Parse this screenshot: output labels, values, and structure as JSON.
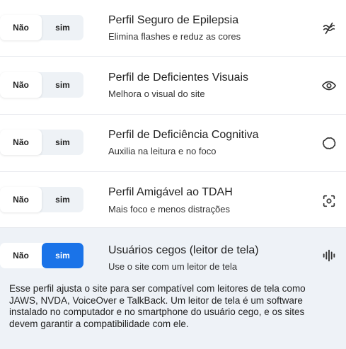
{
  "profiles": [
    {
      "title": "Perfil Seguro de Epilepsia",
      "description": "Elimina flashes e reduz as cores",
      "no_label": "Não",
      "yes_label": "sim",
      "enabled": false,
      "icon": "wave-off-icon"
    },
    {
      "title": "Perfil de Deficientes Visuais",
      "description": "Melhora o visual do site",
      "no_label": "Não",
      "yes_label": "sim",
      "enabled": false,
      "icon": "eye-icon"
    },
    {
      "title": "Perfil de Deficiência Cognitiva",
      "description": "Auxilia na leitura e no foco",
      "no_label": "Não",
      "yes_label": "sim",
      "enabled": false,
      "icon": "brain-outline-icon"
    },
    {
      "title": "Perfil Amigável ao TDAH",
      "description": "Mais foco e menos distrações",
      "no_label": "Não",
      "yes_label": "sim",
      "enabled": false,
      "icon": "focus-target-icon"
    },
    {
      "title": "Usuários cegos (leitor de tela)",
      "description": "Use o site com um leitor de tela",
      "no_label": "Não",
      "yes_label": "sim",
      "enabled": true,
      "icon": "audio-wave-icon",
      "explanation": "Esse perfil ajusta o site para ser compatível com leitores de tela como JAWS, NVDA, VoiceOver e TalkBack. Um leitor de tela é um software instalado no computador e no smartphone do usuário cego, e os sites devem garantir a compatibilidade com ele."
    }
  ],
  "colors": {
    "accent": "#1a73e8",
    "active_row_bg": "#eef2f7",
    "toggle_bg": "#eef2f6"
  }
}
